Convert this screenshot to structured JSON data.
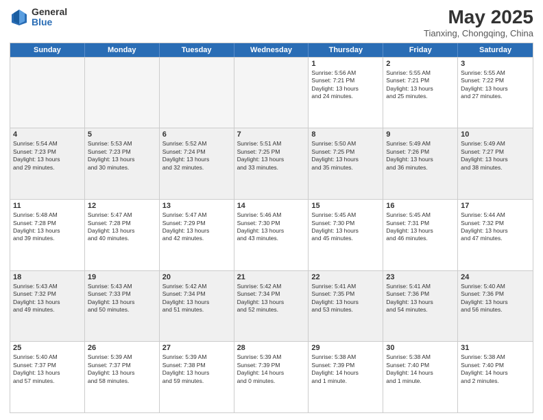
{
  "logo": {
    "general": "General",
    "blue": "Blue"
  },
  "header": {
    "title": "May 2025",
    "subtitle": "Tianxing, Chongqing, China"
  },
  "days_of_week": [
    "Sunday",
    "Monday",
    "Tuesday",
    "Wednesday",
    "Thursday",
    "Friday",
    "Saturday"
  ],
  "weeks": [
    [
      {
        "day": "",
        "info": "",
        "empty": true
      },
      {
        "day": "",
        "info": "",
        "empty": true
      },
      {
        "day": "",
        "info": "",
        "empty": true
      },
      {
        "day": "",
        "info": "",
        "empty": true
      },
      {
        "day": "1",
        "info": "Sunrise: 5:56 AM\nSunset: 7:21 PM\nDaylight: 13 hours\nand 24 minutes.",
        "empty": false
      },
      {
        "day": "2",
        "info": "Sunrise: 5:55 AM\nSunset: 7:21 PM\nDaylight: 13 hours\nand 25 minutes.",
        "empty": false
      },
      {
        "day": "3",
        "info": "Sunrise: 5:55 AM\nSunset: 7:22 PM\nDaylight: 13 hours\nand 27 minutes.",
        "empty": false
      }
    ],
    [
      {
        "day": "4",
        "info": "Sunrise: 5:54 AM\nSunset: 7:23 PM\nDaylight: 13 hours\nand 29 minutes.",
        "empty": false
      },
      {
        "day": "5",
        "info": "Sunrise: 5:53 AM\nSunset: 7:23 PM\nDaylight: 13 hours\nand 30 minutes.",
        "empty": false
      },
      {
        "day": "6",
        "info": "Sunrise: 5:52 AM\nSunset: 7:24 PM\nDaylight: 13 hours\nand 32 minutes.",
        "empty": false
      },
      {
        "day": "7",
        "info": "Sunrise: 5:51 AM\nSunset: 7:25 PM\nDaylight: 13 hours\nand 33 minutes.",
        "empty": false
      },
      {
        "day": "8",
        "info": "Sunrise: 5:50 AM\nSunset: 7:25 PM\nDaylight: 13 hours\nand 35 minutes.",
        "empty": false
      },
      {
        "day": "9",
        "info": "Sunrise: 5:49 AM\nSunset: 7:26 PM\nDaylight: 13 hours\nand 36 minutes.",
        "empty": false
      },
      {
        "day": "10",
        "info": "Sunrise: 5:49 AM\nSunset: 7:27 PM\nDaylight: 13 hours\nand 38 minutes.",
        "empty": false
      }
    ],
    [
      {
        "day": "11",
        "info": "Sunrise: 5:48 AM\nSunset: 7:28 PM\nDaylight: 13 hours\nand 39 minutes.",
        "empty": false
      },
      {
        "day": "12",
        "info": "Sunrise: 5:47 AM\nSunset: 7:28 PM\nDaylight: 13 hours\nand 40 minutes.",
        "empty": false
      },
      {
        "day": "13",
        "info": "Sunrise: 5:47 AM\nSunset: 7:29 PM\nDaylight: 13 hours\nand 42 minutes.",
        "empty": false
      },
      {
        "day": "14",
        "info": "Sunrise: 5:46 AM\nSunset: 7:30 PM\nDaylight: 13 hours\nand 43 minutes.",
        "empty": false
      },
      {
        "day": "15",
        "info": "Sunrise: 5:45 AM\nSunset: 7:30 PM\nDaylight: 13 hours\nand 45 minutes.",
        "empty": false
      },
      {
        "day": "16",
        "info": "Sunrise: 5:45 AM\nSunset: 7:31 PM\nDaylight: 13 hours\nand 46 minutes.",
        "empty": false
      },
      {
        "day": "17",
        "info": "Sunrise: 5:44 AM\nSunset: 7:32 PM\nDaylight: 13 hours\nand 47 minutes.",
        "empty": false
      }
    ],
    [
      {
        "day": "18",
        "info": "Sunrise: 5:43 AM\nSunset: 7:32 PM\nDaylight: 13 hours\nand 49 minutes.",
        "empty": false
      },
      {
        "day": "19",
        "info": "Sunrise: 5:43 AM\nSunset: 7:33 PM\nDaylight: 13 hours\nand 50 minutes.",
        "empty": false
      },
      {
        "day": "20",
        "info": "Sunrise: 5:42 AM\nSunset: 7:34 PM\nDaylight: 13 hours\nand 51 minutes.",
        "empty": false
      },
      {
        "day": "21",
        "info": "Sunrise: 5:42 AM\nSunset: 7:34 PM\nDaylight: 13 hours\nand 52 minutes.",
        "empty": false
      },
      {
        "day": "22",
        "info": "Sunrise: 5:41 AM\nSunset: 7:35 PM\nDaylight: 13 hours\nand 53 minutes.",
        "empty": false
      },
      {
        "day": "23",
        "info": "Sunrise: 5:41 AM\nSunset: 7:36 PM\nDaylight: 13 hours\nand 54 minutes.",
        "empty": false
      },
      {
        "day": "24",
        "info": "Sunrise: 5:40 AM\nSunset: 7:36 PM\nDaylight: 13 hours\nand 56 minutes.",
        "empty": false
      }
    ],
    [
      {
        "day": "25",
        "info": "Sunrise: 5:40 AM\nSunset: 7:37 PM\nDaylight: 13 hours\nand 57 minutes.",
        "empty": false
      },
      {
        "day": "26",
        "info": "Sunrise: 5:39 AM\nSunset: 7:37 PM\nDaylight: 13 hours\nand 58 minutes.",
        "empty": false
      },
      {
        "day": "27",
        "info": "Sunrise: 5:39 AM\nSunset: 7:38 PM\nDaylight: 13 hours\nand 59 minutes.",
        "empty": false
      },
      {
        "day": "28",
        "info": "Sunrise: 5:39 AM\nSunset: 7:39 PM\nDaylight: 14 hours\nand 0 minutes.",
        "empty": false
      },
      {
        "day": "29",
        "info": "Sunrise: 5:38 AM\nSunset: 7:39 PM\nDaylight: 14 hours\nand 1 minute.",
        "empty": false
      },
      {
        "day": "30",
        "info": "Sunrise: 5:38 AM\nSunset: 7:40 PM\nDaylight: 14 hours\nand 1 minute.",
        "empty": false
      },
      {
        "day": "31",
        "info": "Sunrise: 5:38 AM\nSunset: 7:40 PM\nDaylight: 14 hours\nand 2 minutes.",
        "empty": false
      }
    ]
  ]
}
